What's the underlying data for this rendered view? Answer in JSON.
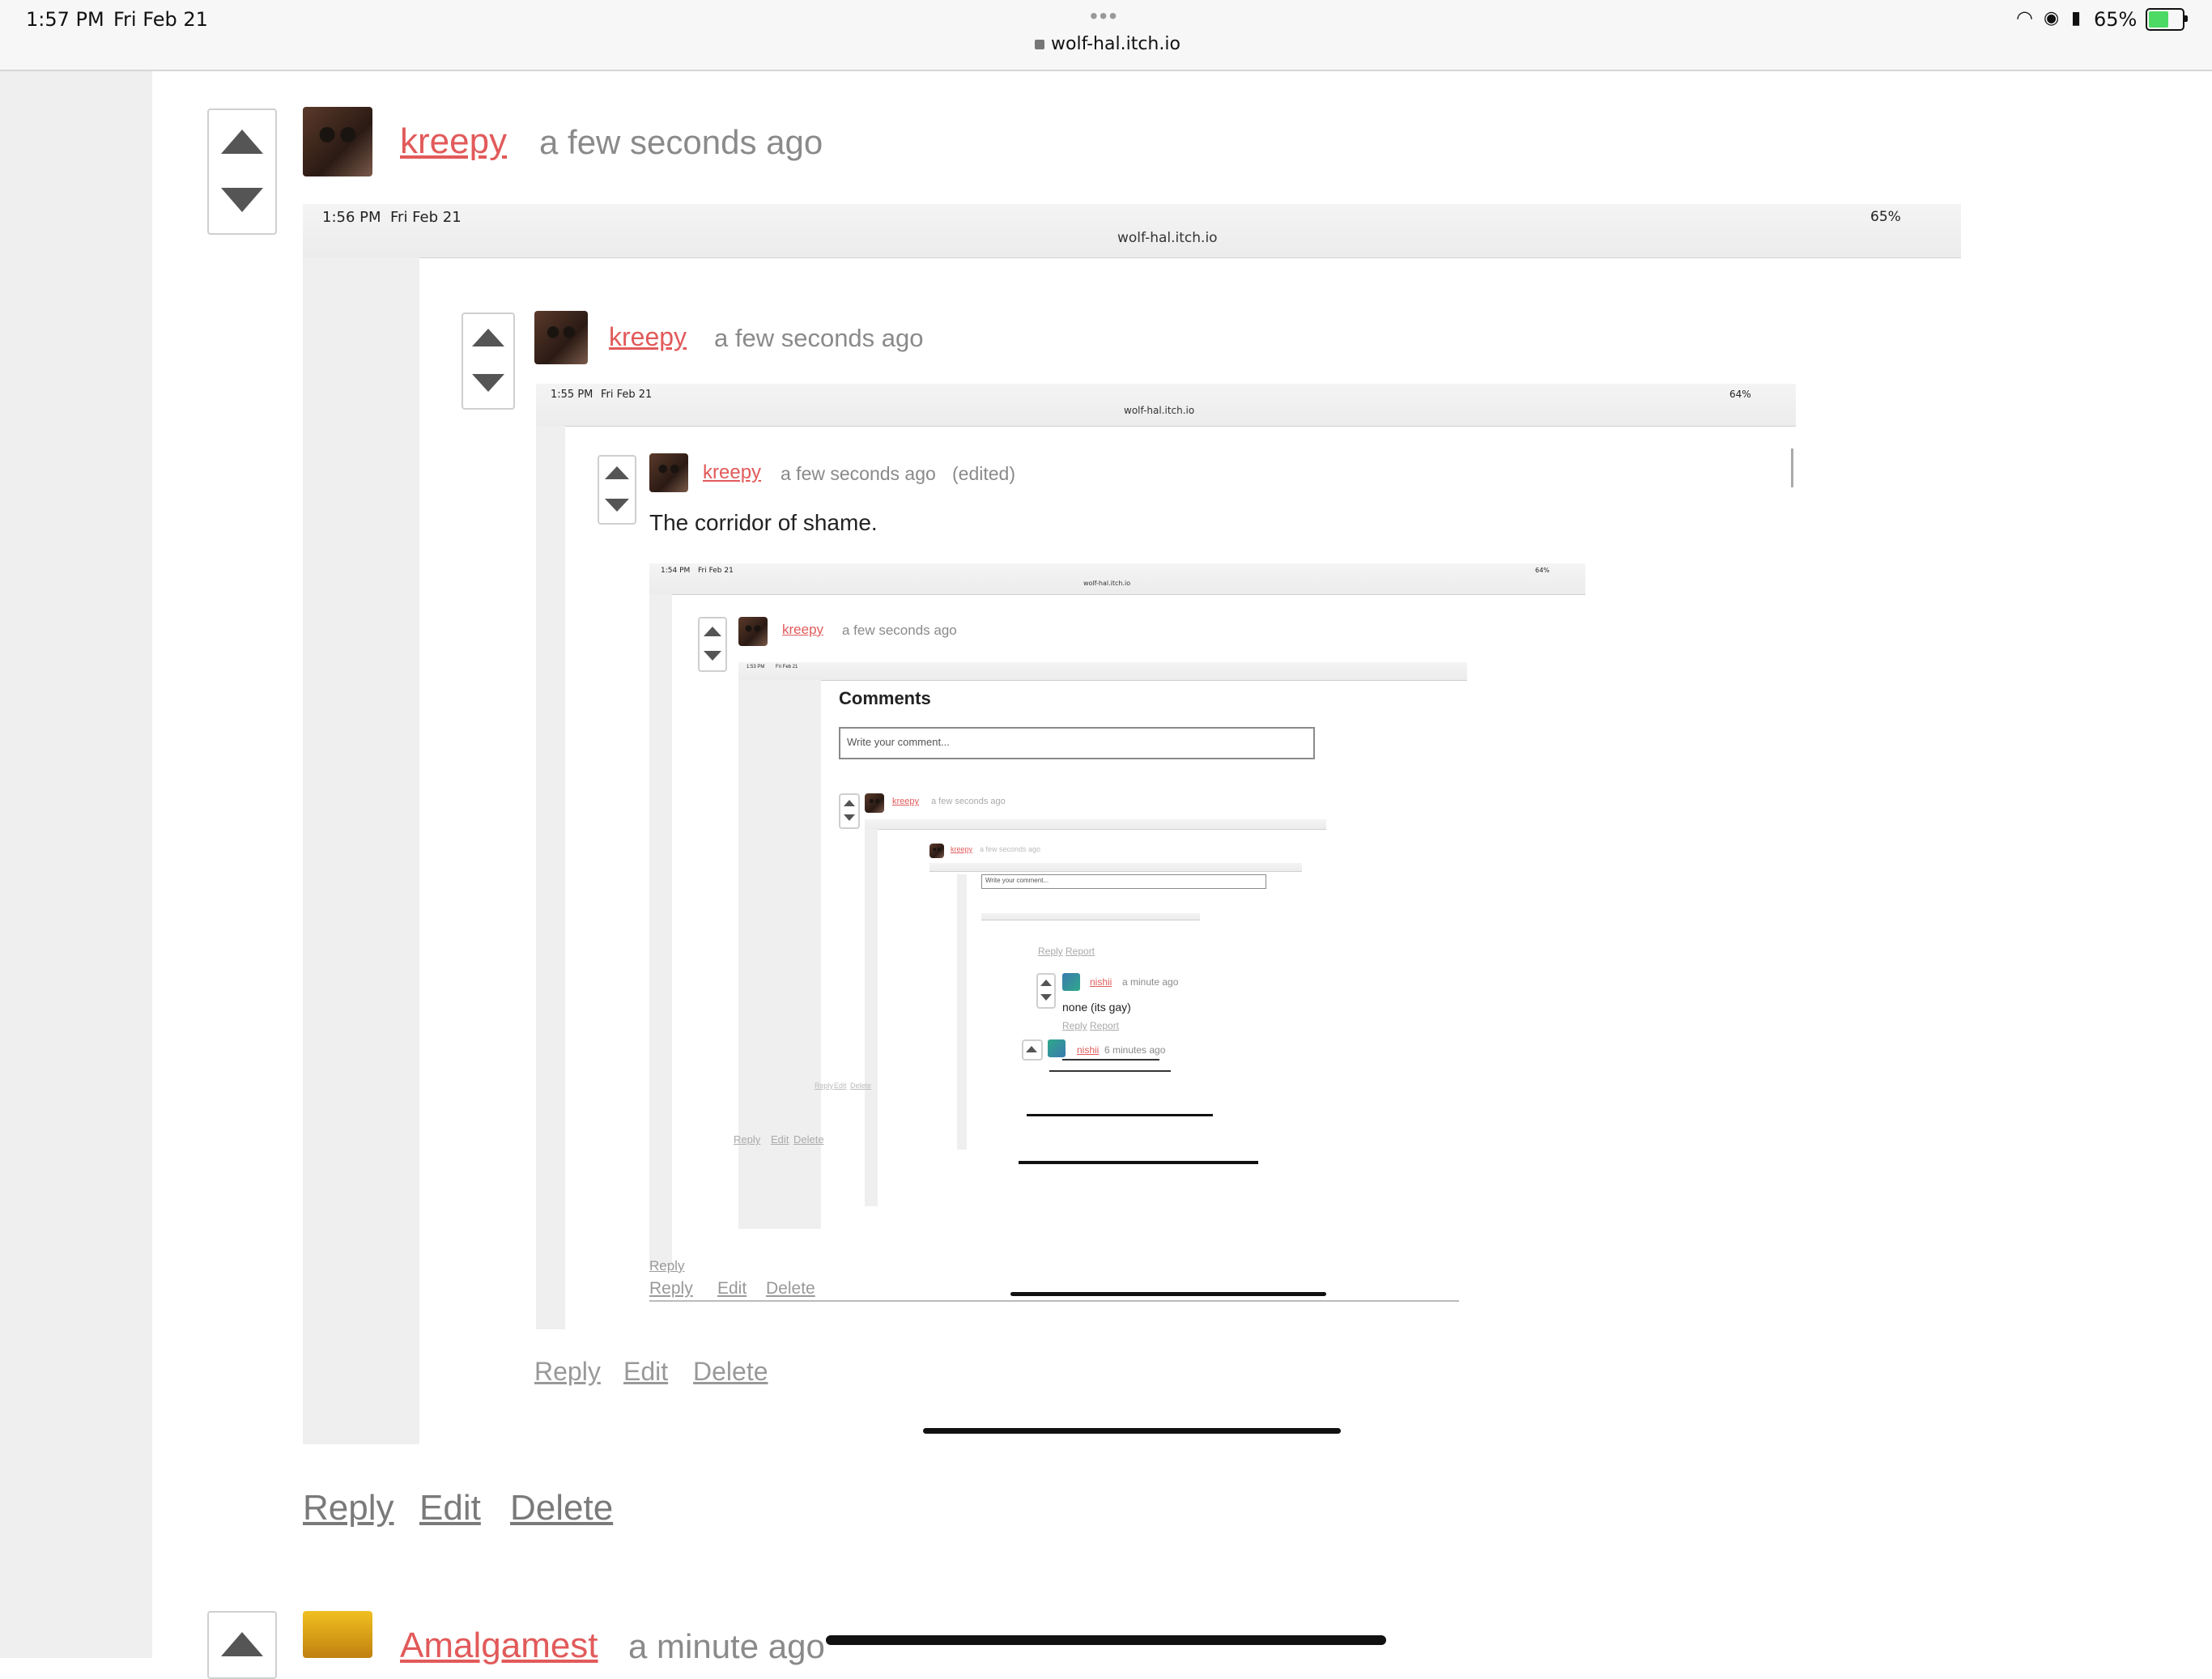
{
  "status_bar": {
    "time": "1:57 PM",
    "date": "Fri Feb 21",
    "dots": "•••",
    "url": "wolf-hal.itch.io",
    "battery": "65%"
  },
  "comment_main": {
    "username": "kreepy",
    "time": "a few seconds ago",
    "actions": [
      "Reply",
      "Edit",
      "Delete"
    ]
  },
  "shot1": {
    "time": "1:56 PM",
    "date": "Fri Feb 21",
    "url": "wolf-hal.itch.io",
    "battery": "65%",
    "username": "kreepy",
    "time_ago": "a few seconds ago",
    "actions": [
      "Reply",
      "Edit",
      "Delete"
    ]
  },
  "shot2": {
    "time": "1:55 PM",
    "date": "Fri Feb 21",
    "url": "wolf-hal.itch.io",
    "battery": "64%",
    "username": "kreepy",
    "time_ago": "a few seconds ago",
    "edited": "(edited)",
    "body": "The corridor of shame.",
    "actions": [
      "Reply",
      "Edit",
      "Delete"
    ]
  },
  "shot3": {
    "time": "1:54 PM",
    "date": "Fri Feb 21",
    "url": "wolf-hal.itch.io",
    "battery": "64%",
    "username": "kreepy",
    "time_ago": "a few seconds ago",
    "actions": [
      "Reply",
      "Edit",
      "Delete"
    ]
  },
  "shot4": {
    "time": "1:53 PM",
    "date": "Fri Feb 21",
    "comments_heading": "Comments",
    "input_placeholder": "Write your comment...",
    "username": "kreepy",
    "time_ago": "a few seconds ago",
    "deep_username": "kreepy",
    "deep_time_ago": "a few seconds ago",
    "deep_input_placeholder": "Write your comment...",
    "reply_report": [
      "Reply",
      "Report"
    ],
    "nishii_1": {
      "username": "nishii",
      "time_ago": "a minute ago",
      "body": "none (its gay)",
      "actions": [
        "Reply",
        "Report"
      ]
    },
    "nishii_2": {
      "username": "nishii",
      "time_ago": "6 minutes ago"
    },
    "actions": [
      "Reply",
      "Edit",
      "Delete"
    ]
  },
  "next_comment": {
    "username": "Amalgamest",
    "time": "a minute ago"
  }
}
